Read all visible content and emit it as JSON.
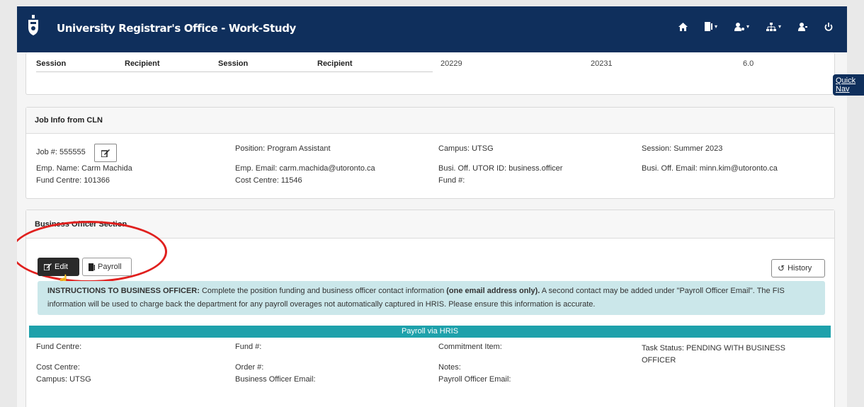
{
  "navbar": {
    "title": "University Registrar's Office - Work-Study",
    "icons": [
      "home-icon",
      "document-icon",
      "user-settings-icon",
      "sitemap-icon",
      "user-icon",
      "power-icon"
    ]
  },
  "quick_nav": {
    "label": "Quick Nav"
  },
  "top_table": {
    "headers": [
      "Session",
      "Recipient",
      "Session",
      "Recipient"
    ],
    "values": [
      "20229",
      "20231",
      "6.0"
    ]
  },
  "job_info": {
    "title": "Job Info from CLN",
    "job_no": "Job #: 555555",
    "position": "Position: Program Assistant",
    "campus": "Campus: UTSG",
    "session": "Session: Summer 2023",
    "emp_name": "Emp. Name: Carm Machida",
    "emp_email": "Emp. Email: carm.machida@utoronto.ca",
    "busi_utor": "Busi. Off. UTOR ID: business.officer",
    "busi_email": "Busi. Off. Email: minn.kim@utoronto.ca",
    "fund_centre": "Fund Centre: 101366",
    "cost_centre": "Cost Centre: 11546",
    "fund_no": "Fund #:"
  },
  "business_officer": {
    "title": "Business Officer Section",
    "edit_label": "Edit",
    "payroll_label": "Payroll",
    "history_label": "History",
    "instructions_lead": "INSTRUCTIONS TO BUSINESS OFFICER:",
    "instructions_text_1": " Complete the position funding and business officer contact information ",
    "instructions_bold": "(one email address only).",
    "instructions_text_2": " A second contact may be added under \"Payroll Officer Email\". The FIS information will be used to charge back the department for any payroll overages not automatically captured in HRIS. Please ensure this information is accurate.",
    "payroll_bar": "Payroll via HRIS",
    "fields": {
      "fund_centre": "Fund Centre:",
      "fund_no": "Fund #:",
      "commitment_item": "Commitment Item:",
      "task_status": "Task Status: PENDING WITH BUSINESS OFFICER",
      "cost_centre": "Cost Centre:",
      "order_no": "Order #:",
      "notes": "Notes:",
      "campus": "Campus: UTSG",
      "bo_email": "Business Officer Email:",
      "po_email": "Payroll Officer Email:"
    }
  },
  "colors": {
    "navbar": "#0f2f5c",
    "teal": "#1ea1ab",
    "instructions_bg": "#cbe7ea",
    "highlight_circle": "#e0201e"
  }
}
